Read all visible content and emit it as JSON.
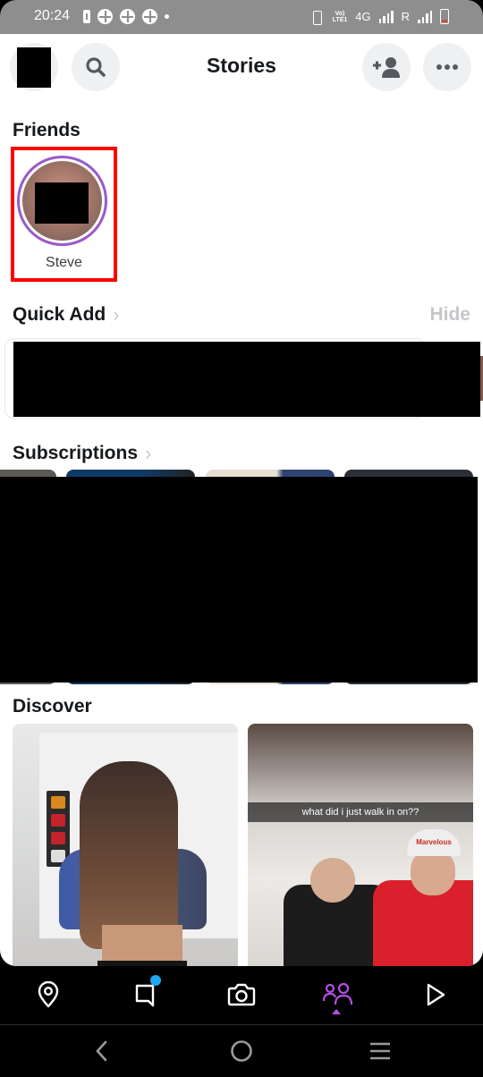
{
  "status_bar": {
    "time": "20:24",
    "left_icons": [
      "battery-saver-icon",
      "app-notification-icon",
      "app-notification-icon",
      "app-notification-icon",
      "more-notifications-dot"
    ],
    "network": {
      "volte": "VoLTE1",
      "type": "4G",
      "roaming": "R"
    },
    "right_icons": [
      "vibrate-icon",
      "volte-icon",
      "signal-4g-icon",
      "roaming-signal-icon",
      "battery-low-icon"
    ]
  },
  "header": {
    "title": "Stories",
    "buttons": [
      {
        "name": "profile-avatar",
        "icon": "avatar"
      },
      {
        "name": "search",
        "icon": "search-icon"
      },
      {
        "name": "add-friend",
        "icon": "add-friend-icon"
      },
      {
        "name": "more",
        "icon": "more-icon"
      }
    ]
  },
  "friends": {
    "title": "Friends",
    "items": [
      {
        "name": "Steve",
        "has_unviewed_story": true
      }
    ]
  },
  "quick_add": {
    "title": "Quick Add",
    "hide_label": "Hide",
    "content": "redacted"
  },
  "subscriptions": {
    "title": "Subscriptions",
    "content": "redacted"
  },
  "discover": {
    "title": "Discover",
    "cards": [
      {
        "caption": ""
      },
      {
        "caption": "what did i just walk in on??",
        "overlay_text": "Marvelous"
      }
    ]
  },
  "bottom_nav": {
    "items": [
      {
        "name": "map",
        "icon": "map-pin-icon",
        "active": false
      },
      {
        "name": "chat",
        "icon": "chat-icon",
        "active": false,
        "has_badge": true
      },
      {
        "name": "camera",
        "icon": "camera-icon",
        "active": false
      },
      {
        "name": "stories",
        "icon": "friends-icon",
        "active": true
      },
      {
        "name": "spotlight",
        "icon": "play-icon",
        "active": false
      }
    ],
    "active_color": "#b24fe3",
    "badge_color": "#1ea7f0"
  },
  "system_nav": {
    "buttons": [
      "back",
      "home",
      "recents"
    ]
  },
  "colors": {
    "story_ring": "#9b59c9",
    "highlight_box": "#ff0000"
  }
}
